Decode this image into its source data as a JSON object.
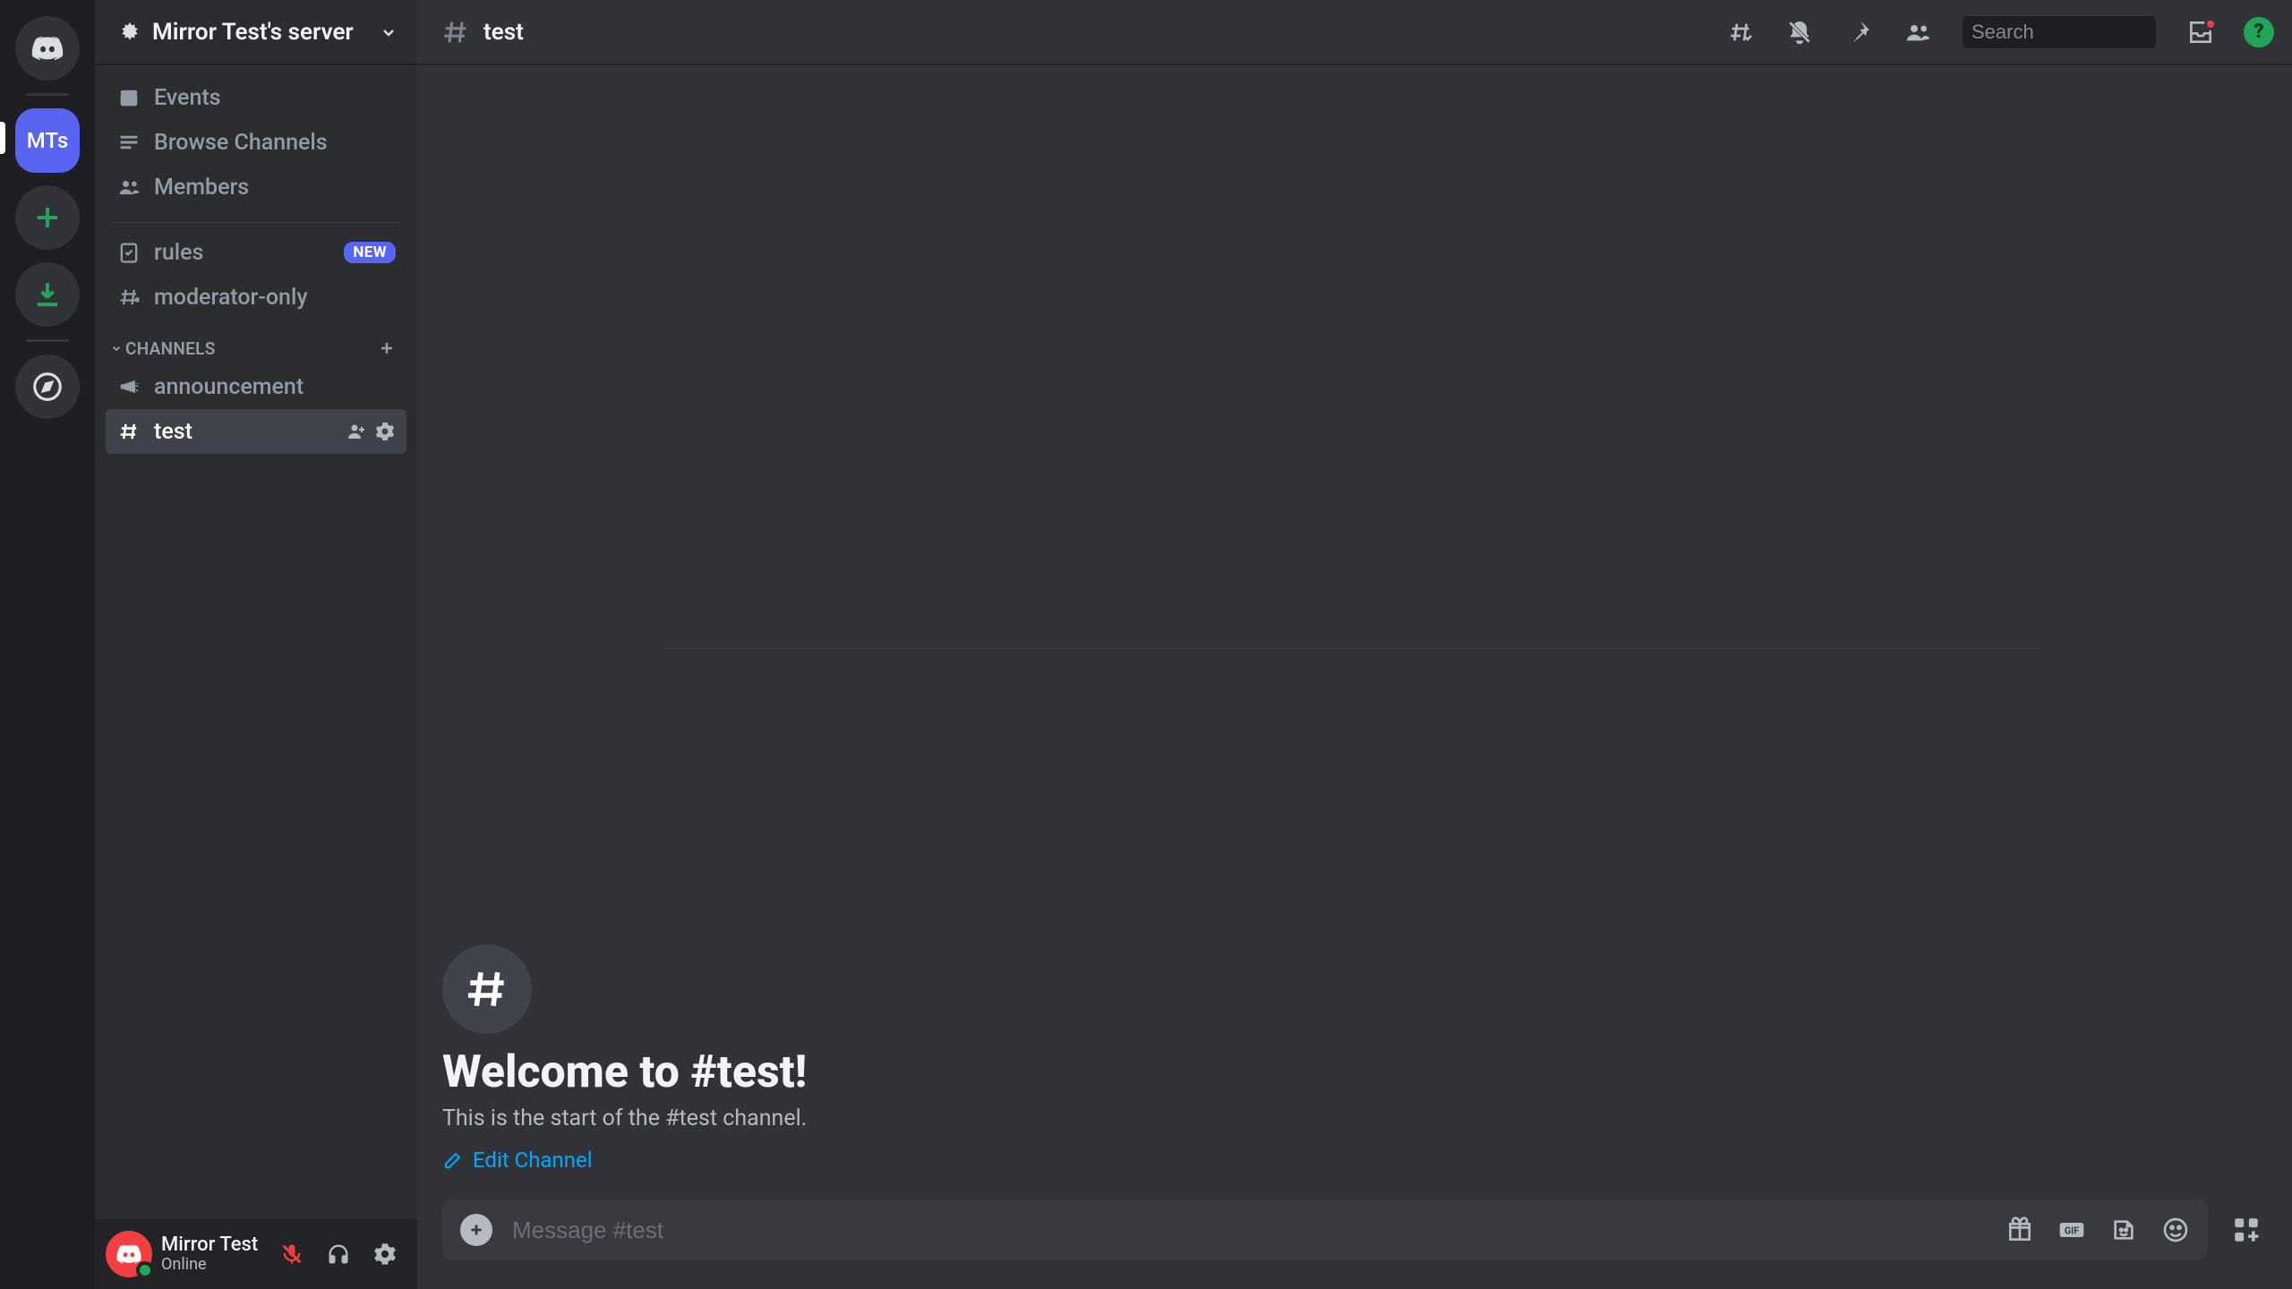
{
  "server": {
    "name": "Mirror Test's server",
    "abbrev": "MTs"
  },
  "sidebar": {
    "events": "Events",
    "browse": "Browse Channels",
    "members": "Members",
    "rules": "rules",
    "new_badge": "NEW",
    "mod_only": "moderator-only",
    "category": "CHANNELS",
    "announcement": "announcement",
    "test": "test"
  },
  "user": {
    "name": "Mirror Test",
    "status": "Online"
  },
  "topbar": {
    "channel": "test",
    "search_placeholder": "Search"
  },
  "welcome": {
    "title": "Welcome to #test!",
    "subtitle": "This is the start of the #test channel.",
    "edit": "Edit Channel"
  },
  "composer": {
    "placeholder": "Message #test"
  },
  "help": "?"
}
